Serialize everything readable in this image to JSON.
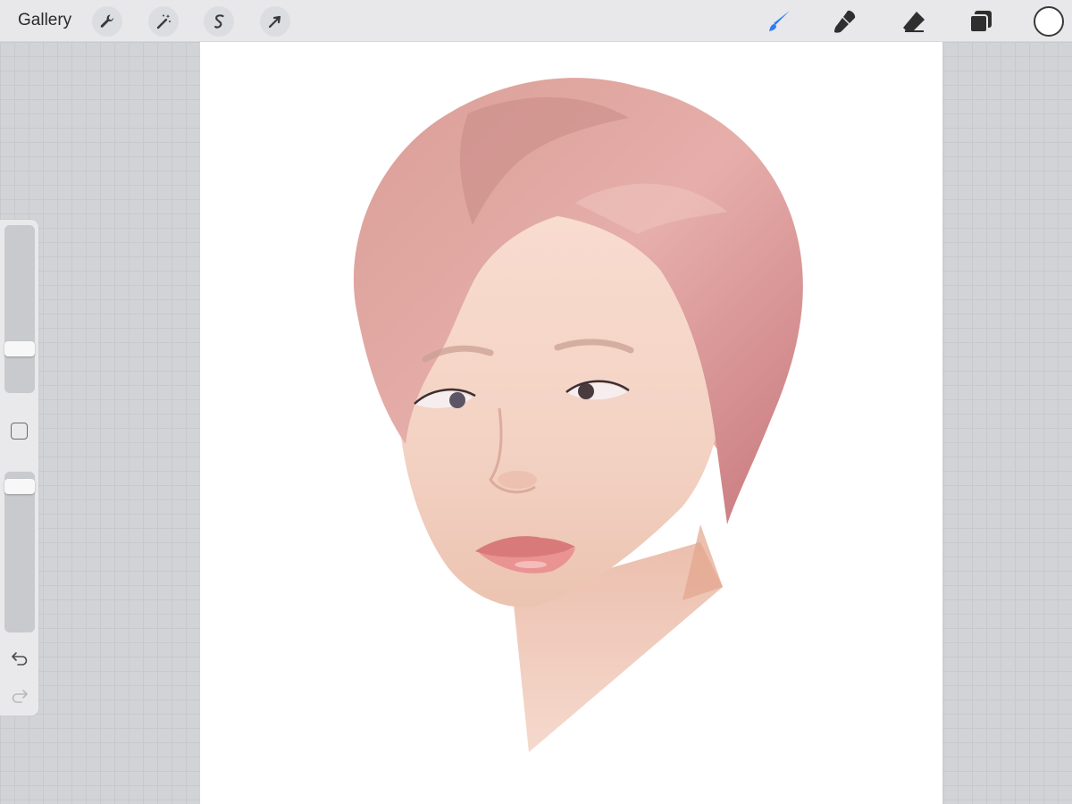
{
  "toolbar": {
    "gallery_label": "Gallery",
    "left_tools": [
      "wrench-icon",
      "magic-wand-icon",
      "selection-s-icon",
      "transform-arrow-icon"
    ],
    "right_tools": [
      "brush-icon",
      "smudge-icon",
      "eraser-icon",
      "layers-icon"
    ],
    "active_tool": "brush",
    "active_color": "#ffffff",
    "accent_color": "#2f7cf6"
  },
  "sidebar": {
    "brush_size_level": 0.24,
    "opacity_level": 0.95
  }
}
